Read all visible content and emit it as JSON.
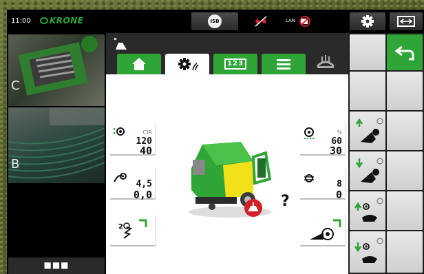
{
  "status_bar": {
    "time": "11:00",
    "brand": "KRONE",
    "isb_label": "ISB",
    "lan_label": "LAN"
  },
  "cameras": [
    {
      "label": "C"
    },
    {
      "label": "B"
    }
  ],
  "camera_more_label": "■■■",
  "tabs": [
    {
      "name": "home",
      "icon": "home-icon"
    },
    {
      "name": "settings",
      "icon": "gear-icon",
      "active": true
    },
    {
      "name": "counters",
      "label": "123",
      "icon": "counter-icon"
    },
    {
      "name": "menu",
      "icon": "menu-icon"
    }
  ],
  "params": {
    "cir": {
      "unit": "CIR",
      "value": "120",
      "value2": "40"
    },
    "pressure": {
      "value": "4,5",
      "value2": "0,0"
    },
    "bale_percent": {
      "unit": "%",
      "value": "60",
      "value2": "30"
    },
    "net": {
      "value": "8",
      "value2": "0"
    }
  },
  "machine_status": "?",
  "colors": {
    "krone_green": "#2fa537",
    "alert_red": "#d0202a"
  }
}
